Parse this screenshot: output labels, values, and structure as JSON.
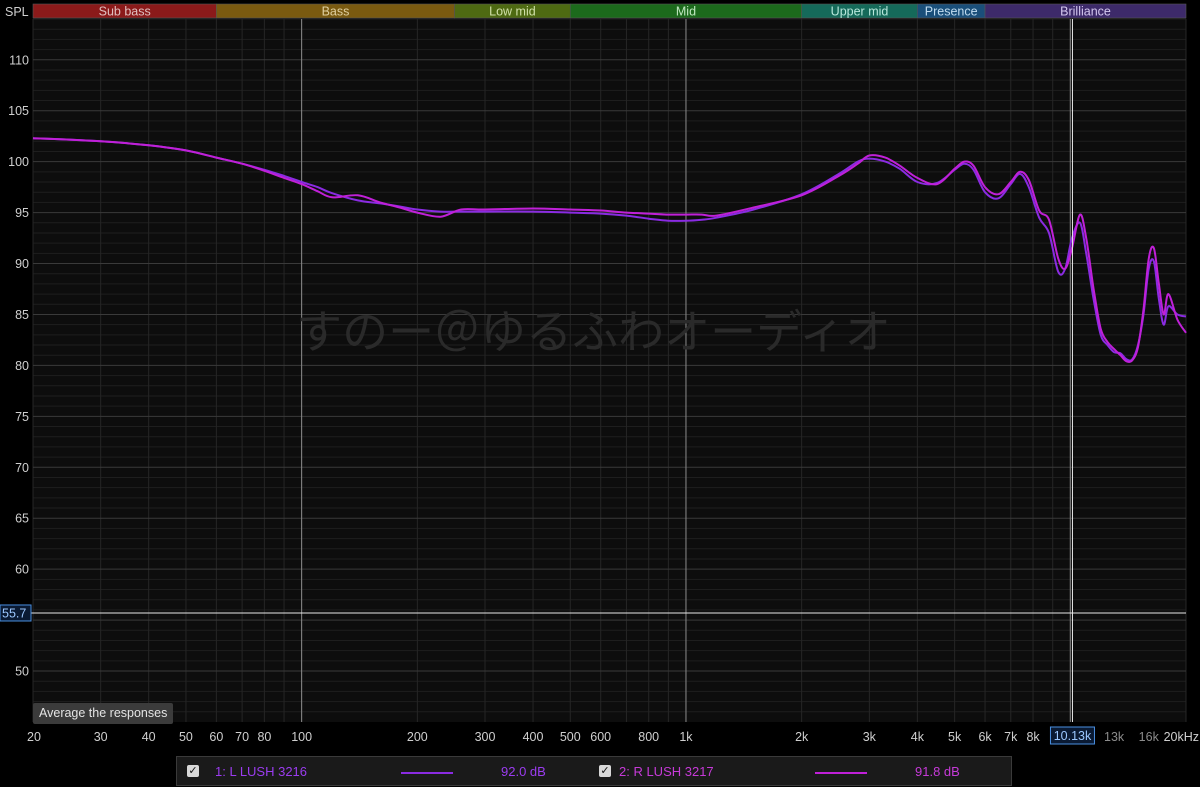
{
  "chart_data": {
    "type": "line",
    "x_scale": "log",
    "xlim": [
      20,
      20000
    ],
    "ylim": [
      45,
      114
    ],
    "ylabel": "SPL",
    "y_ticks": [
      50,
      55,
      60,
      65,
      70,
      75,
      80,
      85,
      90,
      95,
      100,
      105,
      110
    ],
    "y_tick_labels": [
      "50",
      "",
      "60",
      "65",
      "70",
      "75",
      "80",
      "85",
      "90",
      "95",
      "100",
      "105",
      "110"
    ],
    "x_ticks": [
      20,
      30,
      40,
      50,
      60,
      70,
      80,
      100,
      200,
      300,
      400,
      500,
      600,
      800,
      1000,
      2000,
      3000,
      4000,
      5000,
      6000,
      7000,
      8000,
      13000,
      16000,
      20000
    ],
    "x_tick_labels": [
      "20",
      "30",
      "40",
      "50",
      "60",
      "70",
      "80",
      "100",
      "200",
      "300",
      "400",
      "500",
      "600",
      "800",
      "1k",
      "2k",
      "3k",
      "4k",
      "5k",
      "6k",
      "7k",
      "8k",
      "13k",
      "16k",
      "20kHz"
    ],
    "bands": [
      {
        "name": "Sub bass",
        "from": 20,
        "to": 60,
        "color": "#8b1a1a",
        "text_color": "#e0c0c0"
      },
      {
        "name": "Bass",
        "from": 60,
        "to": 250,
        "color": "#7a5a10",
        "text_color": "#e0d0a0"
      },
      {
        "name": "Low mid",
        "from": 250,
        "to": 500,
        "color": "#4e6a12",
        "text_color": "#d0e0a8"
      },
      {
        "name": "Mid",
        "from": 500,
        "to": 2000,
        "color": "#1c6a1c",
        "text_color": "#c0e8c0"
      },
      {
        "name": "Upper mid",
        "from": 2000,
        "to": 4000,
        "color": "#156a5a",
        "text_color": "#b8e8dc"
      },
      {
        "name": "Presence",
        "from": 4000,
        "to": 6000,
        "color": "#1a4f7a",
        "text_color": "#c0dcf0"
      },
      {
        "name": "Brilliance",
        "from": 6000,
        "to": 20000,
        "color": "#3d2a6a",
        "text_color": "#d4c8f0"
      }
    ],
    "cursor": {
      "x": 10130,
      "x_label": "10.13k",
      "y": 55.7,
      "y_label": "55.7"
    },
    "watermark": "すのー＠ゆるふわオーディオ",
    "series": [
      {
        "name": "1: L LUSH 3216",
        "color": "#8a2be2",
        "level": "92.0 dB",
        "x": [
          20,
          30,
          40,
          50,
          60,
          70,
          80,
          90,
          100,
          110,
          120,
          140,
          160,
          180,
          200,
          230,
          260,
          300,
          400,
          500,
          600,
          700,
          800,
          900,
          1000,
          1100,
          1200,
          1500,
          2000,
          2500,
          2800,
          3000,
          3300,
          3600,
          4000,
          4500,
          5000,
          5300,
          5600,
          6000,
          6500,
          7000,
          7400,
          7800,
          8300,
          8800,
          9300,
          9700,
          10100,
          10600,
          11000,
          11500,
          12000,
          12500,
          13000,
          13500,
          14000,
          14500,
          15000,
          15500,
          16000,
          16500,
          17000,
          17500,
          18000,
          19000,
          20000
        ],
        "y": [
          102.3,
          102.0,
          101.6,
          101.1,
          100.4,
          99.8,
          99.2,
          98.6,
          98.0,
          97.5,
          96.9,
          96.2,
          95.9,
          95.6,
          95.3,
          95.1,
          95.1,
          95.1,
          95.1,
          95.0,
          94.9,
          94.7,
          94.4,
          94.2,
          94.2,
          94.3,
          94.5,
          95.3,
          96.8,
          98.8,
          100.0,
          100.3,
          100.0,
          99.3,
          98.0,
          97.9,
          99.2,
          99.8,
          99.2,
          97.0,
          96.4,
          97.8,
          98.8,
          97.5,
          94.5,
          93.0,
          89.2,
          89.5,
          92.5,
          94.0,
          91.0,
          86.5,
          83.0,
          82.0,
          81.3,
          81.2,
          80.6,
          80.6,
          82.0,
          85.0,
          89.5,
          90.2,
          86.5,
          84.0,
          85.8,
          85.0,
          84.8
        ]
      },
      {
        "name": "2: R LUSH 3217",
        "color": "#c020d8",
        "level": "91.8 dB",
        "x": [
          20,
          30,
          40,
          50,
          60,
          70,
          80,
          90,
          100,
          110,
          120,
          140,
          160,
          180,
          200,
          230,
          260,
          300,
          400,
          500,
          600,
          700,
          800,
          900,
          1000,
          1100,
          1200,
          1500,
          2000,
          2500,
          2800,
          3000,
          3300,
          3600,
          4000,
          4500,
          5000,
          5300,
          5600,
          6000,
          6500,
          7000,
          7400,
          7800,
          8300,
          8800,
          9300,
          9700,
          10100,
          10600,
          11000,
          11500,
          12000,
          12500,
          13000,
          13500,
          14000,
          14500,
          15000,
          15500,
          16000,
          16500,
          17000,
          17500,
          18000,
          19000,
          20000
        ],
        "y": [
          102.3,
          102.0,
          101.6,
          101.1,
          100.4,
          99.8,
          99.1,
          98.4,
          97.8,
          97.1,
          96.5,
          96.7,
          96.0,
          95.5,
          95.0,
          94.6,
          95.3,
          95.3,
          95.4,
          95.3,
          95.2,
          95.0,
          94.9,
          94.8,
          94.8,
          94.8,
          94.7,
          95.5,
          96.7,
          98.6,
          99.8,
          100.6,
          100.4,
          99.6,
          98.4,
          97.8,
          99.3,
          100.0,
          99.6,
          97.5,
          96.8,
          98.0,
          99.0,
          98.2,
          95.2,
          94.3,
          90.5,
          89.5,
          91.5,
          94.8,
          92.5,
          87.5,
          83.6,
          82.3,
          81.6,
          81.0,
          80.4,
          80.5,
          81.8,
          85.5,
          90.5,
          91.5,
          88.0,
          85.0,
          87.0,
          84.5,
          83.2
        ]
      }
    ]
  },
  "legend": {
    "items": [
      {
        "check": "✓",
        "name": "1: L LUSH 3216",
        "level": "92.0 dB",
        "color": "#8a2be2"
      },
      {
        "check": "✓",
        "name": "2: R LUSH 3217",
        "level": "91.8 dB",
        "color": "#c020d8"
      }
    ]
  },
  "controls": {
    "average_label": "Average the responses"
  }
}
